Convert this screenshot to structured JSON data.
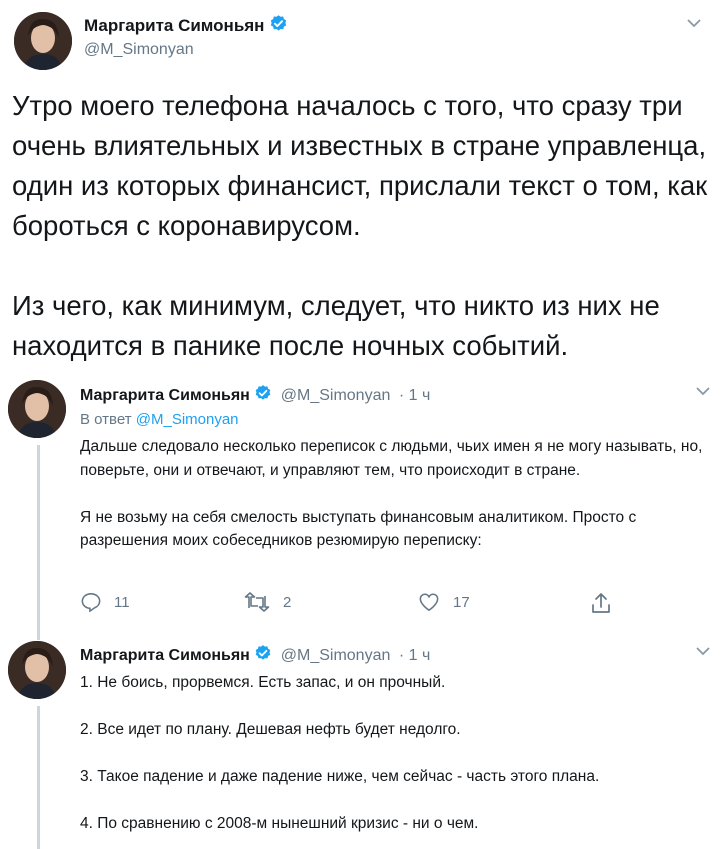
{
  "main_tweet": {
    "author_name": "Маргарита Симоньян",
    "handle": "@M_Simonyan",
    "paragraphs": [
      "Утро моего телефона началось с того, что сразу три очень влиятельных и известных в стране управленца, один из которых финансист, прислали текст о том, как бороться с коронавирусом.",
      "Из чего, как минимум, следует, что никто из них не находится в панике после ночных событий."
    ]
  },
  "replies": [
    {
      "author_name": "Маргарита Симоньян",
      "handle": "@M_Simonyan",
      "time": "· 1 ч",
      "reply_to_label": "В ответ",
      "reply_to_handle": "@M_Simonyan",
      "paragraphs": [
        "Дальше следовало несколько переписок с людьми, чьих имен я не могу называть, но, поверьте, они и отвечают, и управляют тем, что происходит в стране.",
        "Я не возьму на себя смелость выступать финансовым аналитиком. Просто с разрешения моих собеседников резюмирую переписку:"
      ],
      "reply_count": "11",
      "retweet_count": "2",
      "like_count": "17"
    },
    {
      "author_name": "Маргарита Симоньян",
      "handle": "@M_Simonyan",
      "time": "· 1 ч",
      "paragraphs": [
        "1. Не боись, прорвемся. Есть запас, и он прочный.",
        "2. Все идет по плану. Дешевая нефть будет недолго.",
        "3. Такое падение и даже падение ниже, чем сейчас - часть этого плана.",
        "4. По сравнению с 2008-м нынешний кризис - ни о чем."
      ]
    }
  ],
  "icons": {
    "verified": "verified-badge-icon",
    "menu": "chevron-down-icon",
    "reply": "reply-icon",
    "retweet": "retweet-icon",
    "like": "heart-icon",
    "share": "share-icon"
  },
  "colors": {
    "verified": "#1da1f2",
    "link": "#1da1f2",
    "secondary_text": "#657786",
    "thread_line": "#ccd6dd"
  }
}
